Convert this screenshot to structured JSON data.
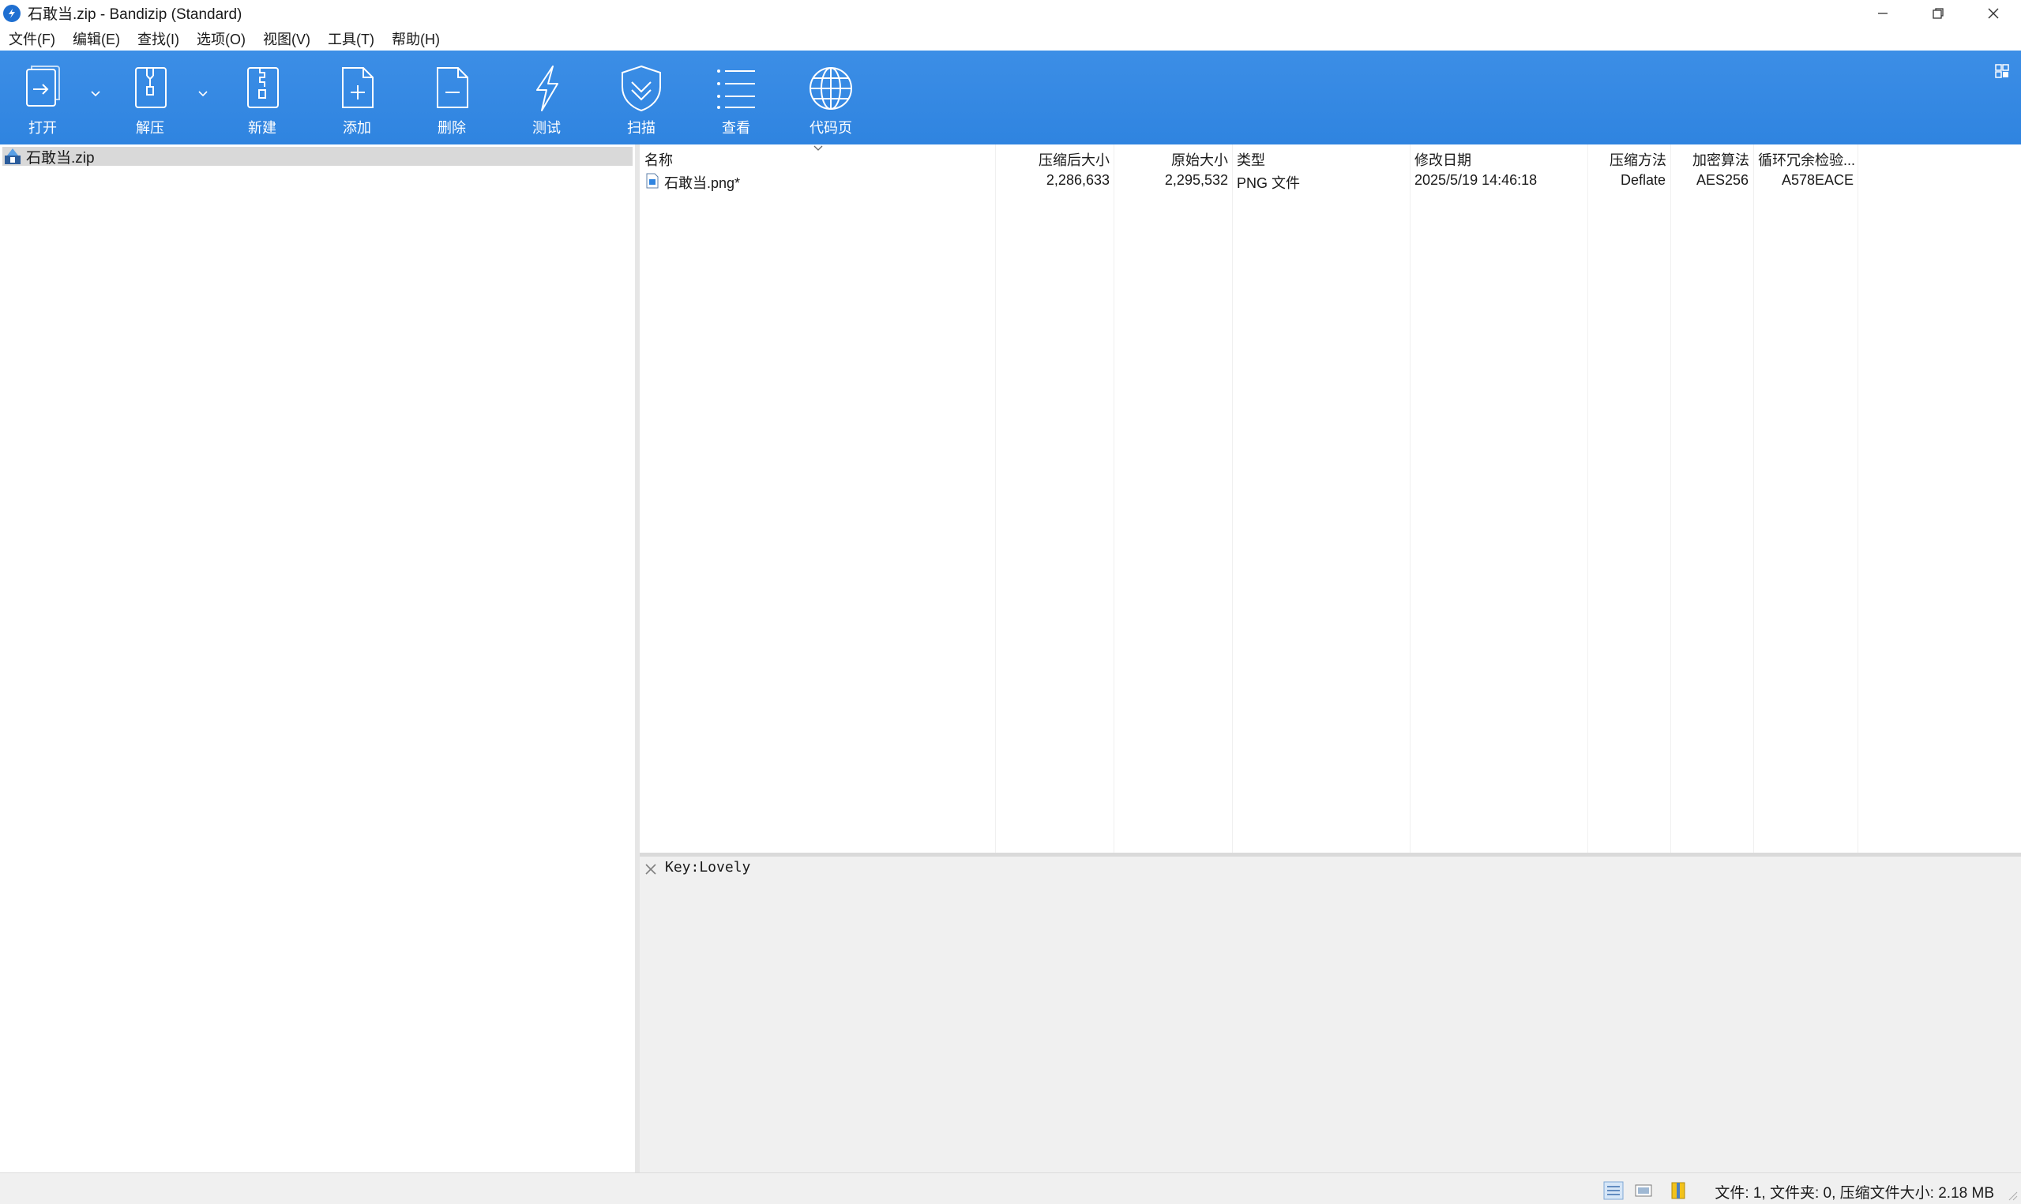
{
  "window": {
    "title": "石敢当.zip - Bandizip (Standard)"
  },
  "menu": [
    "文件(F)",
    "编辑(E)",
    "查找(I)",
    "选项(O)",
    "视图(V)",
    "工具(T)",
    "帮助(H)"
  ],
  "toolbar": {
    "open": "打开",
    "extract": "解压",
    "new": "新建",
    "add": "添加",
    "delete": "删除",
    "test": "测试",
    "scan": "扫描",
    "view": "查看",
    "codepage": "代码页"
  },
  "tree": {
    "root": "石敢当.zip"
  },
  "columns": {
    "name": "名称",
    "packed": "压缩后大小",
    "original": "原始大小",
    "type": "类型",
    "modified": "修改日期",
    "method": "压缩方法",
    "encryption": "加密算法",
    "crc": "循环冗余检验..."
  },
  "files": [
    {
      "name": "石敢当.png*",
      "packed": "2,286,633",
      "original": "2,295,532",
      "type": "PNG 文件",
      "modified": "2025/5/19 14:46:18",
      "method": "Deflate",
      "encryption": "AES256",
      "crc": "A578EACE"
    }
  ],
  "comment": {
    "text": "Key:Lovely"
  },
  "status": {
    "summary": "文件: 1, 文件夹: 0, 压缩文件大小: 2.18 MB"
  },
  "colors": {
    "toolbar": "#2f84e0",
    "selection": "#d9d9d9",
    "comment_bg": "#f0f0f0"
  }
}
